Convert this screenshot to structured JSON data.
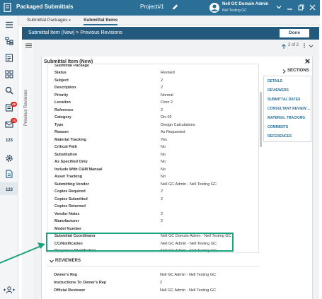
{
  "topbar": {
    "title": "Packaged Submittals",
    "project": "Project#1",
    "user_name": "Nell GC Domain Admin",
    "user_company": "Nell Testing GC"
  },
  "rail": {
    "badge_1": "49",
    "badge_2": "74",
    "text_item_1": "123",
    "text_item_2": "123"
  },
  "tabs": [
    {
      "label": "Submittal Packages",
      "has_dropdown": true
    },
    {
      "label": "Submittal Items",
      "active": true
    }
  ],
  "header": {
    "breadcrumb": "Submittal Item (New)  >  Previous Revisions",
    "done_label": "Done"
  },
  "revisions_panel": {
    "label": "Previous Revisions"
  },
  "pager": {
    "text": "2 of 2"
  },
  "window": {
    "title": "Submittal Item (New)"
  },
  "form": {
    "cut_off_label": "Submittal Package",
    "fields": [
      {
        "label": "Status",
        "value": "Revised"
      },
      {
        "label": "Subject",
        "value": "2"
      },
      {
        "label": "Description",
        "value": "2"
      },
      {
        "label": "Priority",
        "value": "Normal"
      },
      {
        "label": "Location",
        "value": "Floor 2"
      },
      {
        "label": "Reference",
        "value": "2"
      },
      {
        "label": "Category",
        "value": "Div 02"
      },
      {
        "label": "Type",
        "value": "Design Calculations"
      },
      {
        "label": "Reason",
        "value": "As Requested"
      },
      {
        "label": "Material Tracking",
        "value": "Yes"
      },
      {
        "label": "Critical Path",
        "value": "No"
      },
      {
        "label": "Substitution",
        "value": "No"
      },
      {
        "label": "As Specified Only",
        "value": "No"
      },
      {
        "label": "Include With O&M Manual",
        "value": "No"
      },
      {
        "label": "Asset Tracking",
        "value": "No"
      },
      {
        "label": "Submitting Vendor",
        "value": "Nell GC Admin - Nell Testing GC"
      },
      {
        "label": "Copies Required",
        "value": "2"
      },
      {
        "label": "Copies Submitted",
        "value": "2"
      },
      {
        "label": "Copies Returned",
        "value": ""
      },
      {
        "label": "Vendor Notes",
        "value": "2"
      },
      {
        "label": "Manufacturer",
        "value": "2"
      },
      {
        "label": "Model Number",
        "value": ""
      },
      {
        "label": "Submittal Coordinator",
        "value": "Nell GC Domain Admin - Nell Testing GC"
      },
      {
        "label": "CC/Notification",
        "value": "Nell GC Admin - Nell Testing GC"
      },
      {
        "label": "Response Distribution",
        "value": "Nell GC Admin - Nell Testing GC"
      }
    ]
  },
  "sections": {
    "header": "SECTIONS",
    "items": [
      "DETAILS",
      "REVIEWERS",
      "SUBMITTAL DATES",
      "CONSULTANT REVIEW ...",
      "MATERIAL TRACKING",
      "COMMENTS",
      "REFERENCES"
    ]
  },
  "reviewers": {
    "title": "REVIEWERS",
    "fields": [
      {
        "label": "Owner's Rep",
        "value": "Nell GC Admin - Nell Testing GC"
      },
      {
        "label": "Instructions To Owner's Rep",
        "value": "2"
      },
      {
        "label": "Official Reviewer",
        "value": "Nell GC Admin - Nell Testing GC"
      }
    ]
  },
  "colors": {
    "topbar": "#2c6f96",
    "header": "#23597c",
    "accent_link": "#2c6f96",
    "highlight": "#1aa37f",
    "badge": "#d9251c"
  },
  "icons": [
    "app-icon",
    "edit-pencil-icon",
    "avatar-icon",
    "chevron-down-icon",
    "minimize-icon",
    "restore-icon",
    "close-icon",
    "hamburger-menu-icon",
    "hierarchy-icon",
    "forms-icon",
    "dashboard-icon",
    "search-icon",
    "documents-icon",
    "mail-icon",
    "settings-gear-icon",
    "submittals-icon",
    "add-user-icon",
    "arrow-up-icon",
    "more-icon"
  ]
}
